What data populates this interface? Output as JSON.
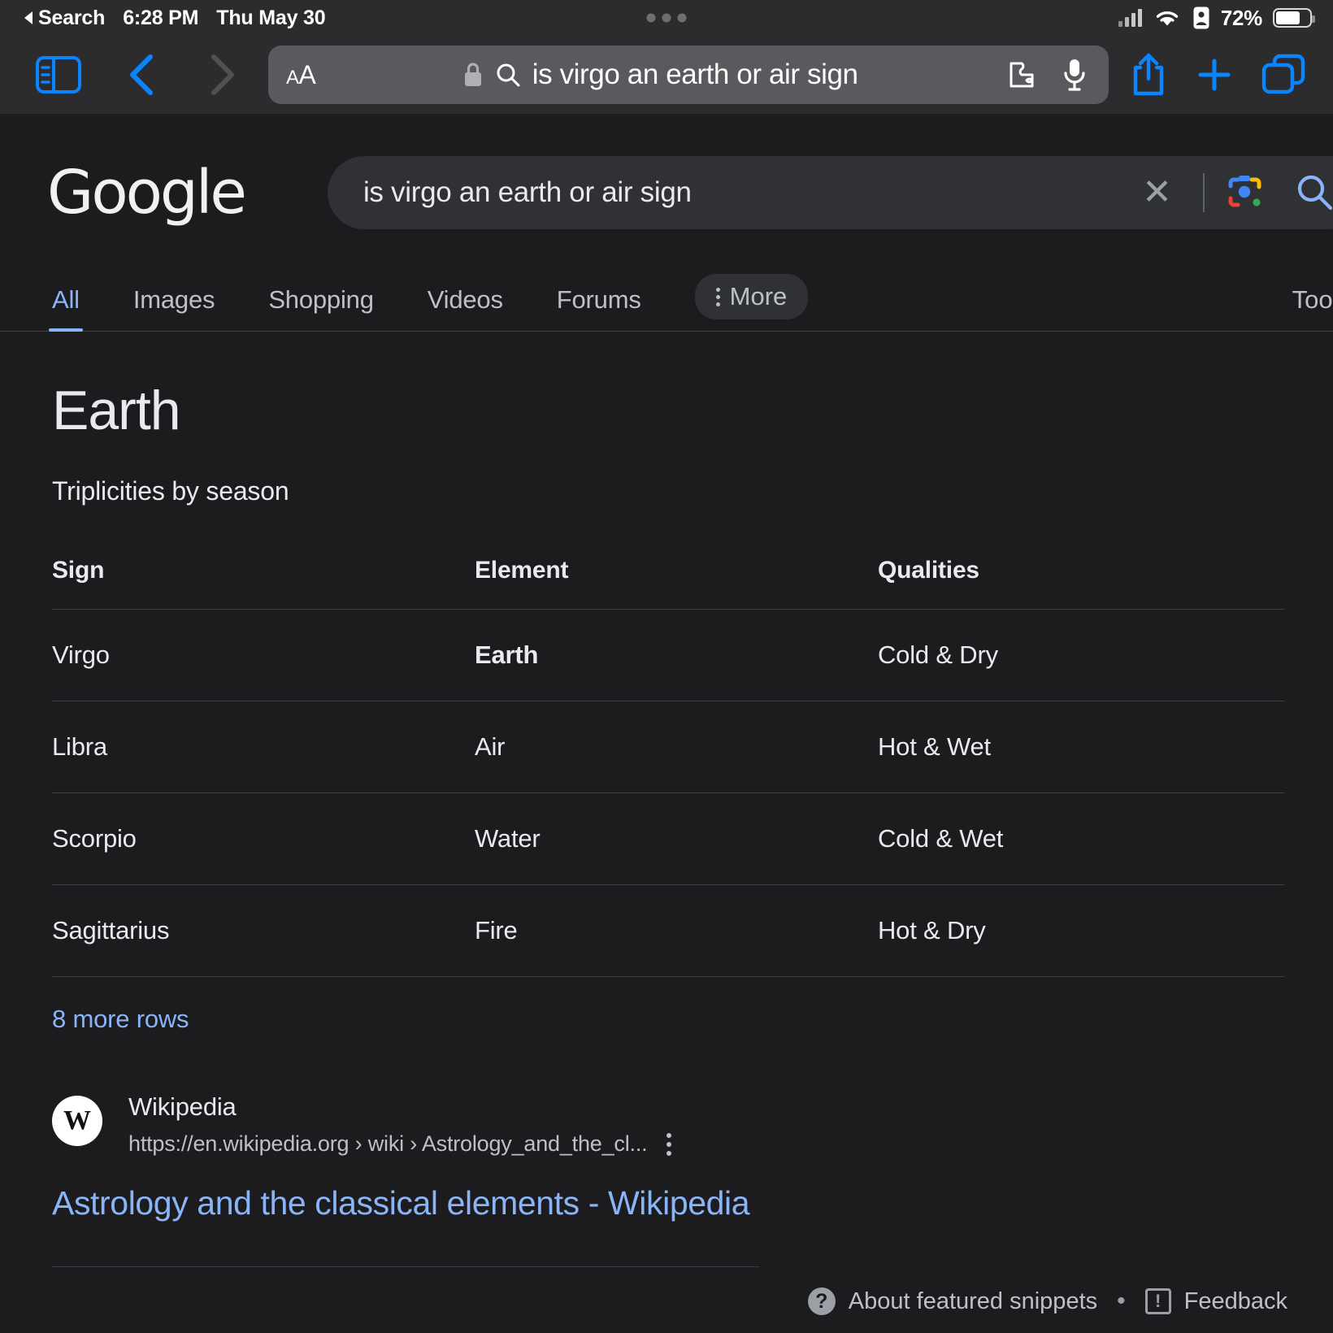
{
  "status_bar": {
    "back_label": "Search",
    "time": "6:28 PM",
    "date": "Thu May 30",
    "battery_percent": "72%",
    "icons": {
      "back_arrow": "triangle-left-icon",
      "cellular": "cellular-bars-icon",
      "wifi": "wifi-icon",
      "lowpower": "battery-saver-icon",
      "battery": "battery-icon",
      "recording_dots": "multitask-dots-icon"
    }
  },
  "browser_toolbar": {
    "sidebar_icon": "sidebar-toggle-icon",
    "back_icon": "chevron-left-icon",
    "forward_icon": "chevron-right-icon",
    "text_size_label": "AA",
    "lock_icon": "lock-icon",
    "search_icon": "search-icon",
    "url_text": "is virgo an earth or air sign",
    "extensions_icon": "puzzle-piece-icon",
    "microphone_icon": "microphone-icon",
    "share_icon": "share-icon",
    "new_tab_icon": "plus-icon",
    "tabs_icon": "tab-overview-icon"
  },
  "google": {
    "logo": "Google",
    "search_value": "is virgo an earth or air sign",
    "clear_icon": "close-icon",
    "lens_icon": "google-lens-icon",
    "search_submit_icon": "search-icon",
    "tabs": [
      {
        "label": "All",
        "active": true
      },
      {
        "label": "Images",
        "active": false
      },
      {
        "label": "Shopping",
        "active": false
      },
      {
        "label": "Videos",
        "active": false
      },
      {
        "label": "Forums",
        "active": false
      }
    ],
    "more_label": "More",
    "tools_label": "Tools"
  },
  "featured_snippet": {
    "answer": "Earth",
    "subtitle": "Triplicities by season",
    "more_rows_label": "8 more rows",
    "table": {
      "headers": [
        "Sign",
        "Element",
        "Qualities"
      ],
      "rows": [
        {
          "sign": "Virgo",
          "element": "Earth",
          "element_bold": true,
          "qualities": "Cold & Dry"
        },
        {
          "sign": "Libra",
          "element": "Air",
          "element_bold": false,
          "qualities": "Hot & Wet"
        },
        {
          "sign": "Scorpio",
          "element": "Water",
          "element_bold": false,
          "qualities": "Cold & Wet"
        },
        {
          "sign": "Sagittarius",
          "element": "Fire",
          "element_bold": false,
          "qualities": "Hot & Dry"
        }
      ]
    },
    "footer": {
      "about_label": "About featured snippets",
      "separator": "•",
      "feedback_label": "Feedback",
      "help_icon": "question-circle-icon",
      "feedback_icon": "flag-icon"
    }
  },
  "result": {
    "site_name": "Wikipedia",
    "favicon_letter": "W",
    "url": "https://en.wikipedia.org › wiki › Astrology_and_the_cl...",
    "menu_icon": "kebab-menu-icon",
    "title": "Astrology and the classical elements - Wikipedia"
  },
  "colors": {
    "accent_blue": "#8ab4f8",
    "ios_blue": "#0a84ff",
    "page_bg": "#1c1c1e",
    "chrome_bg": "#2c2c2e",
    "divider": "#3c4043"
  }
}
